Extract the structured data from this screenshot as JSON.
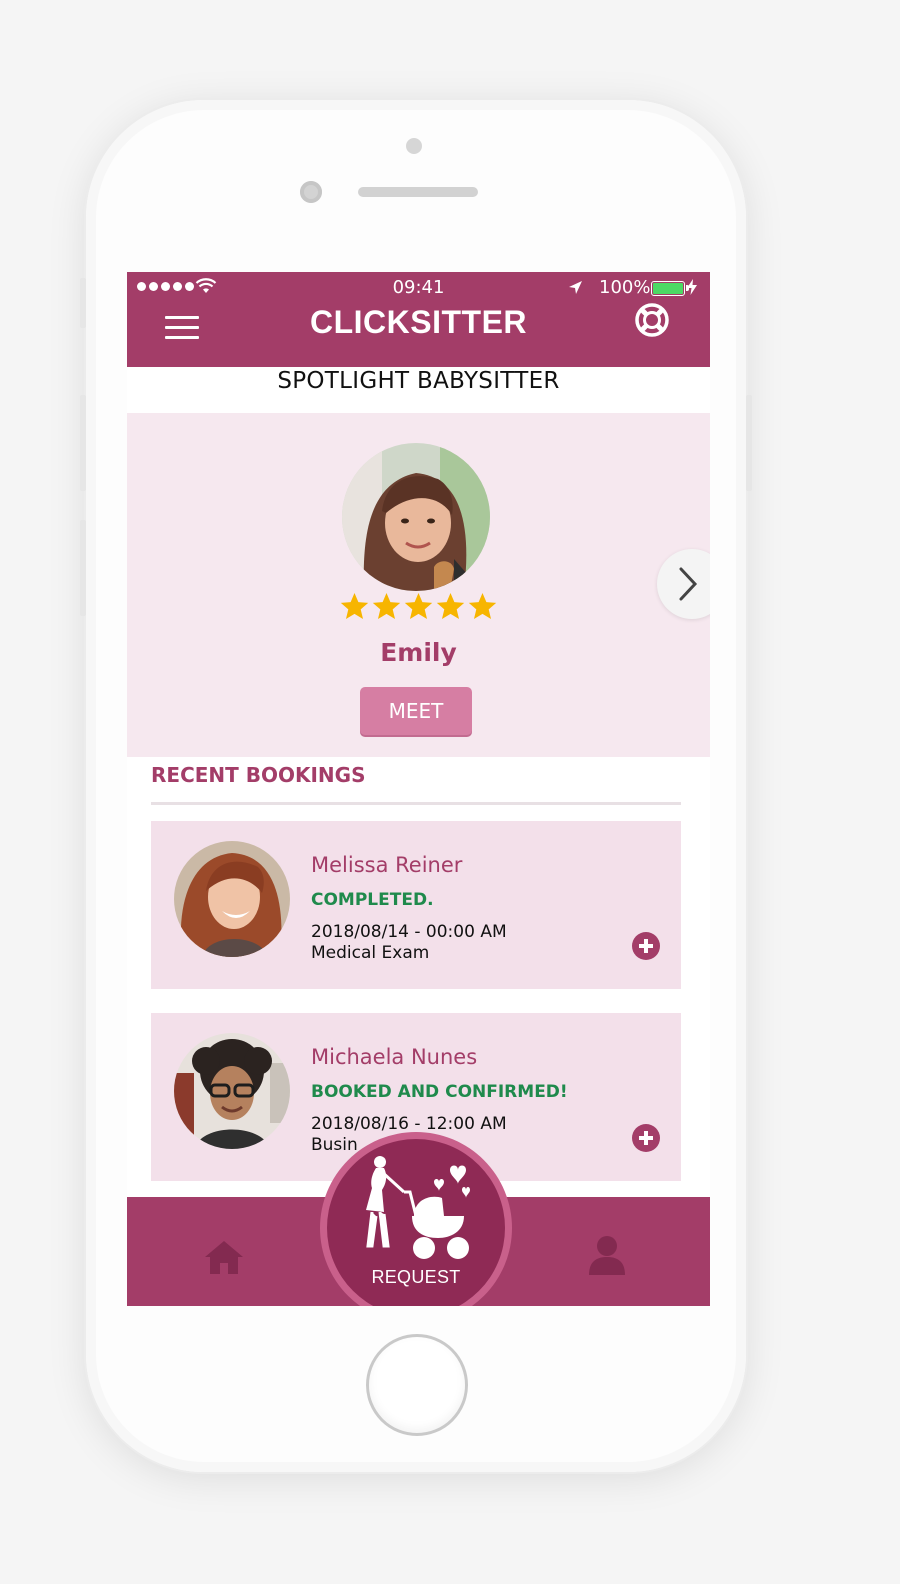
{
  "status_bar": {
    "time": "09:41",
    "battery": "100%"
  },
  "app": {
    "title": "CLICKSITTER",
    "brand_color": "#a33d68"
  },
  "spotlight": {
    "heading": "SPOTLIGHT BABYSITTER",
    "name": "Emily",
    "rating": 5,
    "meet_label": "MEET"
  },
  "recent": {
    "heading": "RECENT BOOKINGS",
    "bookings": [
      {
        "name": "Melissa Reiner",
        "status": "COMPLETED.",
        "datetime": "2018/08/14 - 00:00 AM",
        "reason": "Medical Exam"
      },
      {
        "name": "Michaela Nunes",
        "status": "BOOKED AND CONFIRMED!",
        "datetime": "2018/08/16 - 12:00 AM",
        "reason": "Busin"
      }
    ]
  },
  "bottom_nav": {
    "request_label": "REQUEST",
    "icons": [
      "home-icon",
      "stroller-icon",
      "user-icon"
    ]
  }
}
